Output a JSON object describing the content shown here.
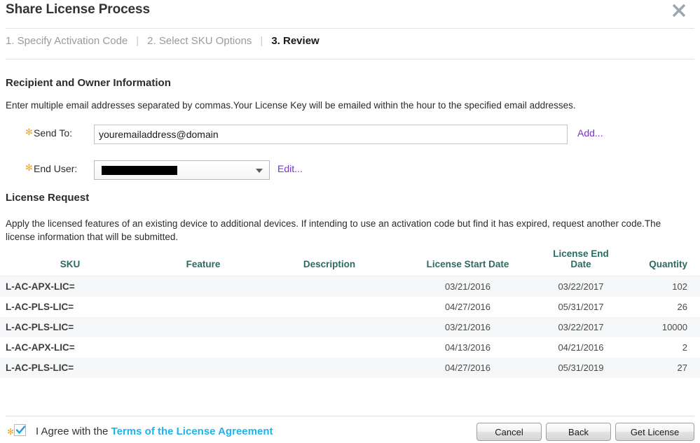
{
  "dialog": {
    "title": "Share License Process",
    "close_icon": "close-icon"
  },
  "steps": [
    {
      "label": "1. Specify Activation Code",
      "active": false
    },
    {
      "label": "2. Select SKU Options",
      "active": false
    },
    {
      "label": "3. Review",
      "active": true
    }
  ],
  "step_separator": "|",
  "recipient": {
    "section_title": "Recipient and Owner Information",
    "description": "Enter multiple email addresses separated by commas.Your License Key will be emailed within the hour to the specified email addresses.",
    "required_marker": "✻",
    "send_to": {
      "label": "Send To:",
      "value": "youremailaddress@domain",
      "placeholder": "",
      "add_link": "Add..."
    },
    "end_user": {
      "label": "End User:",
      "selected": "",
      "edit_link": "Edit..."
    }
  },
  "license_request": {
    "section_title": "License Request",
    "description": "Apply the licensed features of an existing device to additional devices. If intending to use an activation code but find it has expired, request another code.The license information that will be submitted.",
    "columns": [
      "SKU",
      "Feature",
      "Description",
      "License Start Date",
      "License End Date",
      "Quantity"
    ],
    "rows": [
      {
        "sku": "L-AC-APX-LIC=",
        "feature": "",
        "description": "",
        "start": "03/21/2016",
        "end": "03/22/2017",
        "quantity": "102"
      },
      {
        "sku": "L-AC-PLS-LIC=",
        "feature": "",
        "description": "",
        "start": "04/27/2016",
        "end": "05/31/2017",
        "quantity": "26"
      },
      {
        "sku": "L-AC-PLS-LIC=",
        "feature": "",
        "description": "",
        "start": "03/21/2016",
        "end": "03/22/2017",
        "quantity": "10000"
      },
      {
        "sku": "L-AC-APX-LIC=",
        "feature": "",
        "description": "",
        "start": "04/13/2016",
        "end": "04/21/2016",
        "quantity": "2"
      },
      {
        "sku": "L-AC-PLS-LIC=",
        "feature": "",
        "description": "",
        "start": "04/27/2016",
        "end": "05/31/2019",
        "quantity": "27"
      }
    ]
  },
  "footer": {
    "required_marker": "✻",
    "agree_checked": true,
    "agree_prefix": "I Agree with the ",
    "agree_link": "Terms of the License Agreement",
    "buttons": {
      "cancel": "Cancel",
      "back": "Back",
      "get_license": "Get License"
    }
  },
  "colors": {
    "table_header": "#2b6a63",
    "link_purple": "#7a2fd4",
    "link_cyan": "#1fb3ec",
    "required_star": "#f5a623",
    "active_step": "#1a1a1a",
    "inactive_step": "#9b9b9b"
  }
}
